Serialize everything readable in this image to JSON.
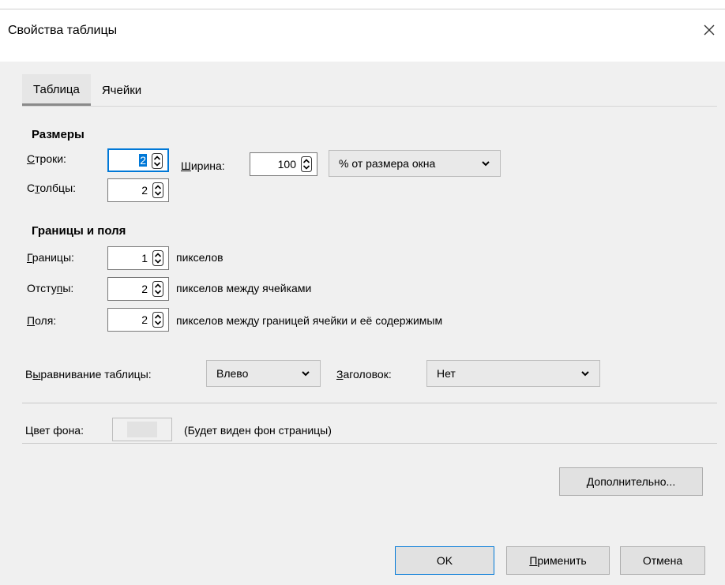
{
  "window": {
    "title": "Свойства таблицы",
    "close_glyph": "close-icon"
  },
  "tabs": [
    {
      "label": "Таблица",
      "active": true
    },
    {
      "label": "Ячейки",
      "active": false
    }
  ],
  "sizes": {
    "title": "Размеры",
    "rows_label": "Строки:",
    "rows_label_u": "С",
    "rows_label_rest": "троки:",
    "rows_value": "2",
    "cols_label_pre": "С",
    "cols_label_u": "т",
    "cols_label_rest": "олбцы:",
    "cols_value": "2",
    "width_label_u": "Ш",
    "width_label_rest": "ирина:",
    "width_value": "100",
    "width_unit": "% от размера окна"
  },
  "borders": {
    "title": "Границы и поля",
    "border_label_u": "Г",
    "border_label_rest": "раницы:",
    "border_value": "1",
    "border_unit": "пикселов",
    "spacing_label_pre": "Отсту",
    "spacing_label_u": "п",
    "spacing_label_rest": "ы:",
    "spacing_value": "2",
    "spacing_unit": "пикселов между ячейками",
    "padding_label_u": "П",
    "padding_label_rest": "оля:",
    "padding_value": "2",
    "padding_unit": "пикселов между границей ячейки и её содержимым"
  },
  "alignment": {
    "label_pre": "В",
    "label_u": "ы",
    "label_rest": "равнивание таблицы:",
    "value": "Влево",
    "caption_label_u": "З",
    "caption_label_rest": "аголовок:",
    "caption_value": "Нет"
  },
  "background": {
    "label": "Цвет фона:",
    "note": "(Будет виден фон страницы)"
  },
  "buttons": {
    "advanced": "Дополнительно...",
    "ok": "OK",
    "apply_u": "П",
    "apply_rest": "рименить",
    "cancel": "Отмена"
  }
}
